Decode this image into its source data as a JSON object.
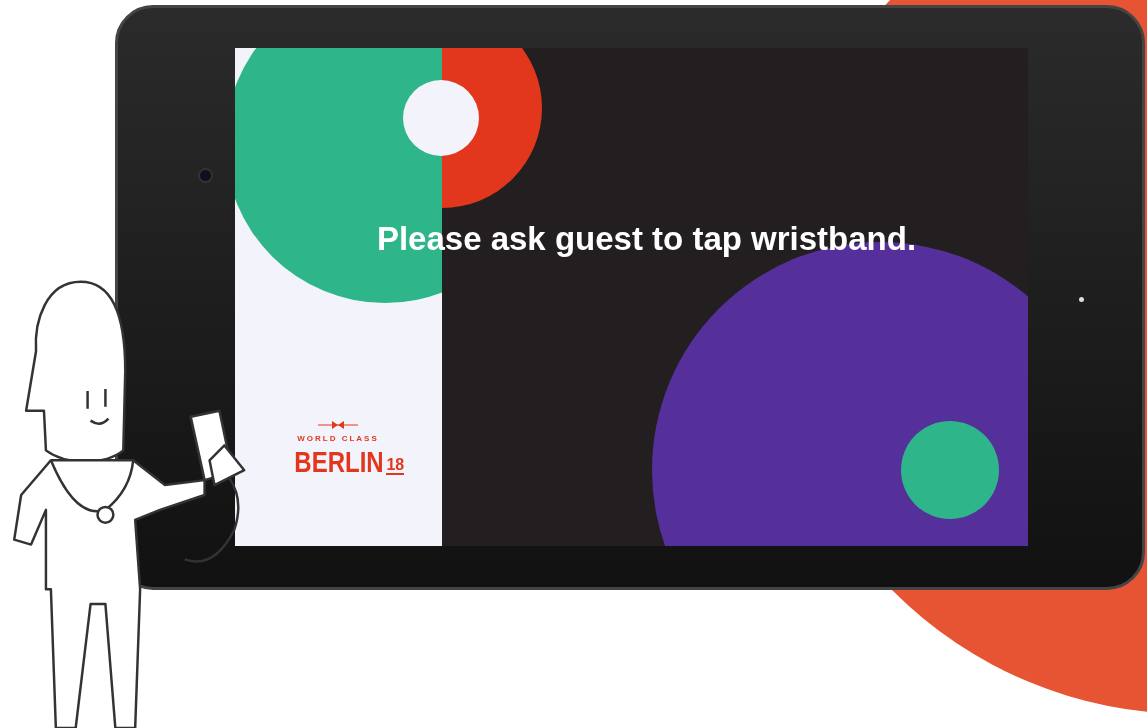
{
  "screen": {
    "message": "Please ask guest to tap wristband.",
    "logo": {
      "tagline": "WORLD CLASS",
      "city": "BERLIN",
      "year": "18"
    }
  }
}
